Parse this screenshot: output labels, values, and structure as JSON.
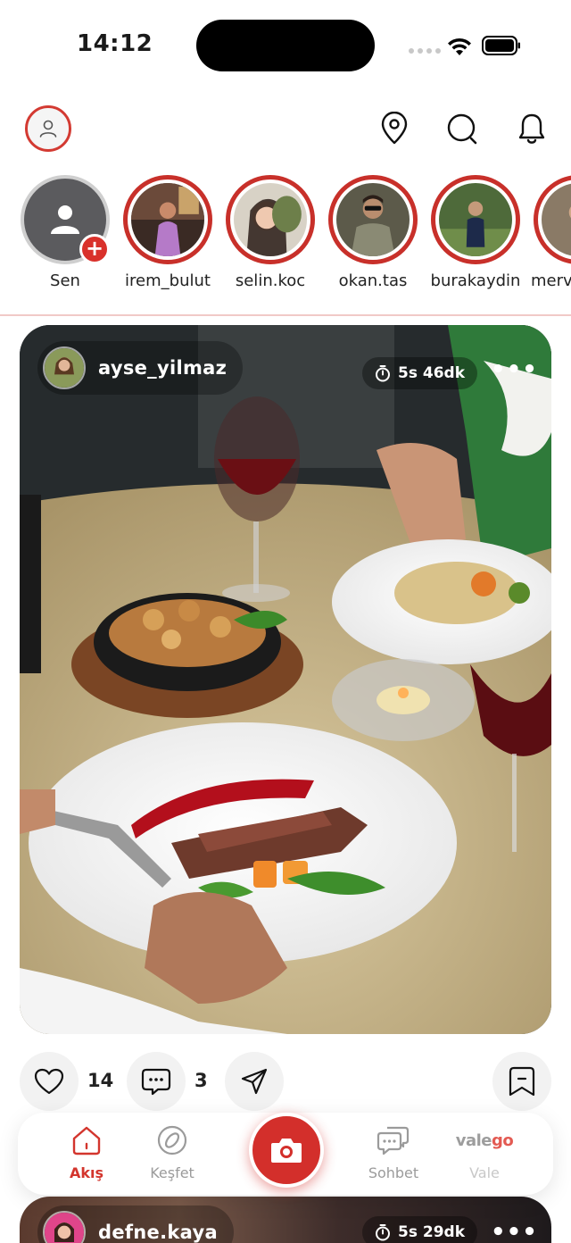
{
  "status_bar": {
    "time": "14:12"
  },
  "header": {
    "profile_icon": "user-icon",
    "icons": [
      "location-pin-icon",
      "search-icon",
      "bell-icon"
    ]
  },
  "stories": [
    {
      "name": "Sen",
      "own": true
    },
    {
      "name": "irem_bulut"
    },
    {
      "name": "selin.koc"
    },
    {
      "name": "okan.tas"
    },
    {
      "name": "burakaydin"
    },
    {
      "name": "merve"
    }
  ],
  "post": {
    "username": "ayse_yilmaz",
    "time": "5s 46dk",
    "more": "•••",
    "likes": "14",
    "comments": "3"
  },
  "bottom_nav": {
    "items": [
      {
        "label": "Akış",
        "active": true
      },
      {
        "label": "Keşfet"
      },
      {
        "label": "Sohbet"
      },
      {
        "label": "Vale"
      }
    ],
    "logo_main": "vale",
    "logo_accent": "go"
  },
  "post2": {
    "username": "defne.kaya",
    "time": "5s 29dk",
    "more": "•••"
  },
  "colors": {
    "accent": "#d32f2b",
    "nav_inactive": "#9b9b9b",
    "divider": "#f1c9c7"
  }
}
